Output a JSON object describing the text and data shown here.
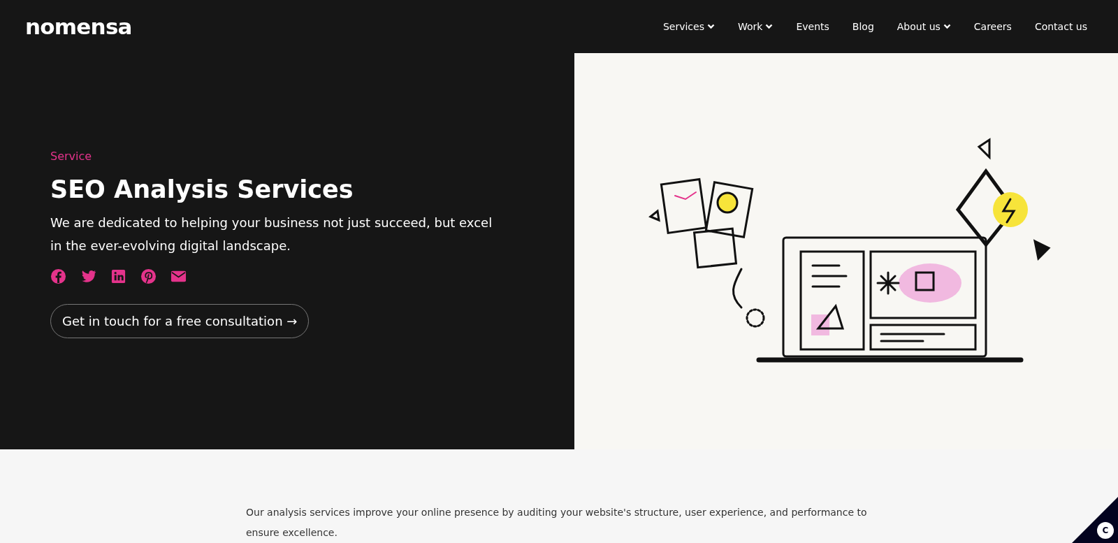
{
  "header": {
    "logo": "nomensa",
    "nav": [
      {
        "label": "Services",
        "has_menu": true
      },
      {
        "label": "Work",
        "has_menu": true
      },
      {
        "label": "Events",
        "has_menu": false
      },
      {
        "label": "Blog",
        "has_menu": false
      },
      {
        "label": "About us",
        "has_menu": true
      },
      {
        "label": "Careers",
        "has_menu": false
      },
      {
        "label": "Contact us",
        "has_menu": false
      }
    ]
  },
  "hero": {
    "eyebrow": "Service",
    "title": "SEO Analysis Services",
    "lead": "We are dedicated to helping your business not just succeed, but excel in the ever-evolving digital landscape.",
    "share": [
      {
        "kind": "facebook"
      },
      {
        "kind": "twitter"
      },
      {
        "kind": "linkedin"
      },
      {
        "kind": "pinterest"
      },
      {
        "kind": "email"
      }
    ],
    "cta": "Get in touch for a free consultation →"
  },
  "intro": {
    "text": "Our analysis services improve your online presence by auditing your website's structure, user experience, and performance to ensure excellence."
  },
  "cookie_button": {
    "label": "C"
  }
}
